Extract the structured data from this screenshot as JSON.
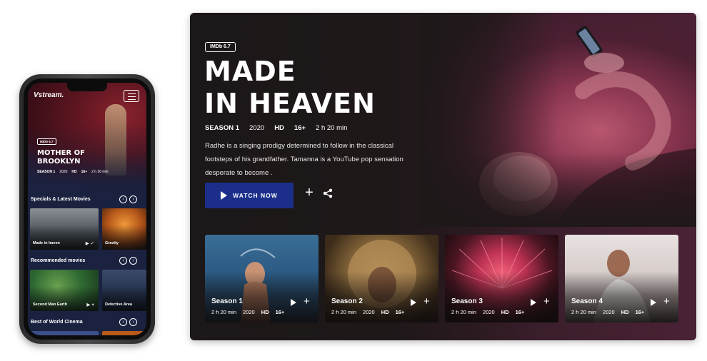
{
  "tv": {
    "imdb": "IMDb 6.7",
    "title_line1": "MADE",
    "title_line2": "IN HEAVEN",
    "meta": {
      "season": "SEASON 1",
      "year": "2020",
      "quality": "HD",
      "rating": "16+",
      "duration": "2 h 20 min"
    },
    "description": "Radhe is a singing prodigy determined to follow in the classical footsteps of his grandfather. Tamanna is a YouTube pop sensation desperate to become .",
    "watch_label": "WATCH NOW",
    "seasons": [
      {
        "title": "Season 1",
        "duration": "2 h 20 min",
        "year": "2020",
        "quality": "HD",
        "rating": "16+"
      },
      {
        "title": "Season 2",
        "duration": "2 h 20 min",
        "year": "2020",
        "quality": "HD",
        "rating": "16+"
      },
      {
        "title": "Season 3",
        "duration": "2 h 20 min",
        "year": "2020",
        "quality": "HD",
        "rating": "16+"
      },
      {
        "title": "Season 4",
        "duration": "2 h 20 min",
        "year": "2020",
        "quality": "HD",
        "rating": "16+"
      }
    ]
  },
  "phone": {
    "logo": "stream.",
    "imdb": "IMDb 6.7",
    "title": "MOTHER OF BROOKLYN",
    "meta": {
      "season": "SEASON 1",
      "year": "2020",
      "quality": "HD",
      "rating": "16+",
      "duration": "2 h 20 min"
    },
    "sections": [
      {
        "title": "Specials & Latest Movies",
        "cards": [
          "Made in haven",
          "Gravity"
        ]
      },
      {
        "title": "Recommended movies",
        "cards": [
          "Second Man Earth",
          "Defective Area"
        ]
      },
      {
        "title": "Best of World Cinema"
      }
    ]
  },
  "colors": {
    "accent_button": "#1b2f8a",
    "tv_background": "#1e1819",
    "phone_background": "#1a2240"
  }
}
